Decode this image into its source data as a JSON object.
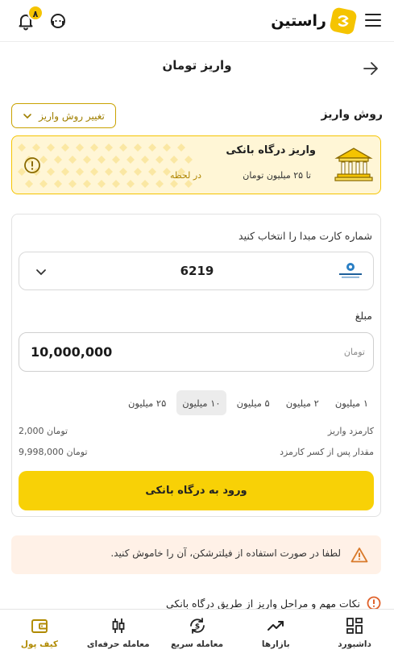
{
  "header": {
    "brand_name": "راستین",
    "notification_count": "۸"
  },
  "page": {
    "title": "واریز تومان"
  },
  "deposit_method": {
    "label": "روش واریز",
    "change_button": "تغییر روش واریز"
  },
  "gateway": {
    "title": "واریز درگاه بانکی",
    "limit": "تا ۲۵ میلیون تومان",
    "speed": "در لحظه"
  },
  "form": {
    "card_prompt": "شماره کارت مبدا را انتخاب کنید",
    "card_number": "6219",
    "bank_logo_text": "بانک سامان",
    "amount_label": "مبلغ",
    "amount_value": "10,000,000",
    "amount_unit": "تومان",
    "quick_amounts": [
      {
        "label": "۱ میلیون",
        "active": false
      },
      {
        "label": "۲ میلیون",
        "active": false
      },
      {
        "label": "۵ میلیون",
        "active": false
      },
      {
        "label": "۱۰ میلیون",
        "active": true
      },
      {
        "label": "۲۵ میلیون",
        "active": false
      }
    ],
    "fee_label": "کارمزد واریز",
    "fee_value": "2,000 تومان",
    "net_label": "مقدار پس از کسر کارمزد",
    "net_value": "9,998,000 تومان",
    "submit_label": "ورود به درگاه بانکی"
  },
  "warning": {
    "text": "لطفا در صورت استفاده از فیلترشکن، آن را خاموش کنید."
  },
  "tips": {
    "heading": "نکات مهم و مراحل واریز از طریق درگاه بانکی"
  },
  "bottom_nav": {
    "items": [
      {
        "label": "داشبورد",
        "icon": "dashboard-icon"
      },
      {
        "label": "بازارها",
        "icon": "markets-icon"
      },
      {
        "label": "معامله سریع",
        "icon": "quick-trade-icon"
      },
      {
        "label": "معامله حرفه‌ای",
        "icon": "pro-trade-icon"
      },
      {
        "label": "کیف پول",
        "icon": "wallet-icon"
      }
    ],
    "active_index": 4
  },
  "colors": {
    "accent": "#f8d106",
    "accent_dark": "#b08a00",
    "gateway_bg": "#fff6d6",
    "warning_bg": "#fff1e7"
  }
}
